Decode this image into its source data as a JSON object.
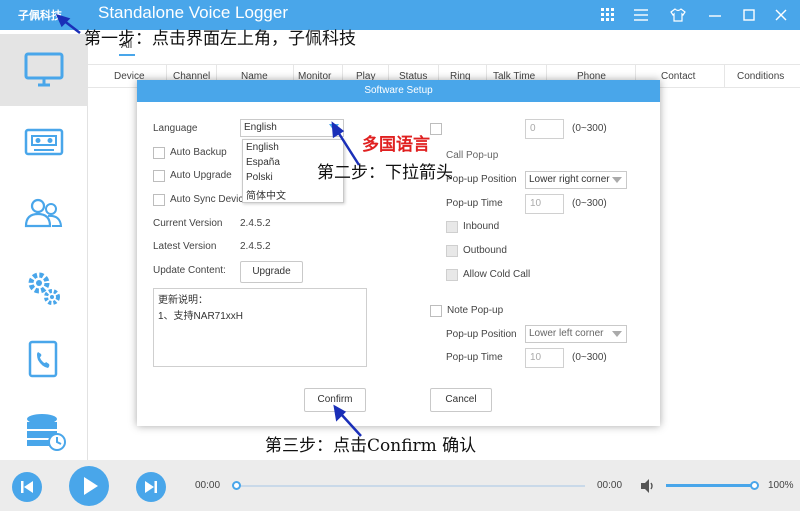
{
  "titlebar": {
    "brand": "子佩科技",
    "app_title": "Standalone Voice Logger",
    "icons": [
      "grid-icon",
      "list-icon",
      "shirt-icon",
      "minimize-icon",
      "maximize-icon",
      "close-icon"
    ]
  },
  "sidebar": {
    "items": [
      {
        "icon": "monitor-icon",
        "active": true
      },
      {
        "icon": "cassette-icon",
        "active": false
      },
      {
        "icon": "users-icon",
        "active": false
      },
      {
        "icon": "gears-icon",
        "active": false
      },
      {
        "icon": "phone-book-icon",
        "active": false
      },
      {
        "icon": "database-icon",
        "active": false
      }
    ]
  },
  "main": {
    "tab_all": "All",
    "columns": [
      "Device",
      "Channel",
      "Name",
      "Monitor",
      "Play",
      "Status",
      "Ring",
      "Talk Time",
      "Phone",
      "Contact",
      "Conditions"
    ]
  },
  "modal": {
    "title": "Software Setup",
    "language_label": "Language",
    "language_value": "English",
    "language_options": [
      "English",
      "España",
      "Polski",
      "简体中文"
    ],
    "auto_backup": "Auto Backup",
    "auto_upgrade": "Auto Upgrade",
    "auto_sync": "Auto Sync Devic",
    "current_version_label": "Current Version",
    "current_version": "2.4.5.2",
    "latest_version_label": "Latest Version",
    "latest_version": "2.4.5.2",
    "update_content_label": "Update Content:",
    "upgrade_button": "Upgrade",
    "notes_line1": "更新说明：",
    "notes_line2": "1、支持NAR71xxH",
    "top_number": "0",
    "range_text": "(0~300)",
    "call_popup": "Call Pop-up",
    "popup_position_label": "Pop-up Position",
    "popup_position_value": "Lower right corner",
    "popup_time_label": "Pop-up Time",
    "popup_time_value": "10",
    "inbound": "Inbound",
    "outbound": "Outbound",
    "allow_cold_call": "Allow Cold Call",
    "note_popup": "Note Pop-up",
    "note_position_label": "Pop-up Position",
    "note_position_value": "Lower left corner",
    "note_time_label": "Pop-up Time",
    "note_time_value": "10",
    "note_range_text": "(0~300)",
    "confirm_button": "Confirm",
    "cancel_button": "Cancel"
  },
  "player": {
    "time_start": "00:00",
    "time_end": "00:00",
    "volume": "100%",
    "progress_fraction": 0.0,
    "volume_fraction": 1.0
  },
  "annotations": {
    "step1": "第一步：点击界面左上角，子佩科技",
    "multi_lang": "多国语言",
    "step2": "第二步：下拉箭头",
    "step3": "第三步：点击Confirm 确认"
  },
  "colors": {
    "accent": "#49a6ea",
    "annotation_red": "#e02020",
    "arrow": "#1a2fb8"
  }
}
